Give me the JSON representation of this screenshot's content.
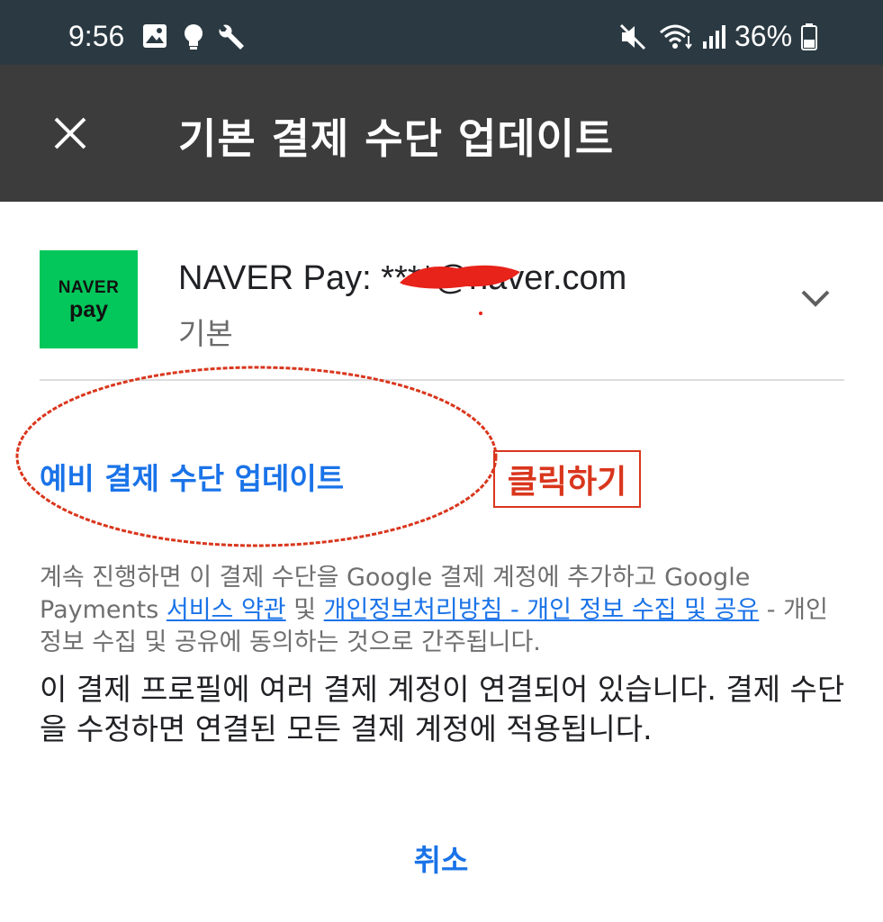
{
  "status_bar": {
    "time": "9:56",
    "battery": "36%",
    "icons": [
      "gallery-icon",
      "bulb-icon",
      "wrench-icon",
      "mute-icon",
      "wifi-icon",
      "signal-icon",
      "battery-icon"
    ]
  },
  "header": {
    "title": "기본 결제 수단 업데이트",
    "close_icon": "close-icon"
  },
  "payment_method": {
    "logo_line1": "NAVER",
    "logo_line2": "pay",
    "name": "NAVER Pay: ****@naver.com",
    "subtitle": "기본"
  },
  "backup_link": "예비 결제 수단 업데이트",
  "annotation": {
    "label": "클릭하기",
    "color": "#d9361d"
  },
  "legal": {
    "prefix": "계속 진행하면 이 결제 수단을 Google 결제 계정에 추가하고 Google Payments ",
    "terms_link": "서비스 약관",
    "and": " 및 ",
    "privacy_link": "개인정보처리방침 - 개인 정보 수집 및 공유",
    "suffix": " - 개인정보 수집 및 공유에 동의하는 것으로 간주됩니다."
  },
  "notice": "이 결제 프로필에 여러 결제 계정이 연결되어 있습니다. 결제 수단을 수정하면 연결된 모든 결제 계정에 적용됩니다.",
  "cancel_label": "취소",
  "colors": {
    "accent": "#1a73e8",
    "naver_green": "#03c75a",
    "title_bar": "#3c3c3c",
    "status_bar": "#2b3a42"
  }
}
